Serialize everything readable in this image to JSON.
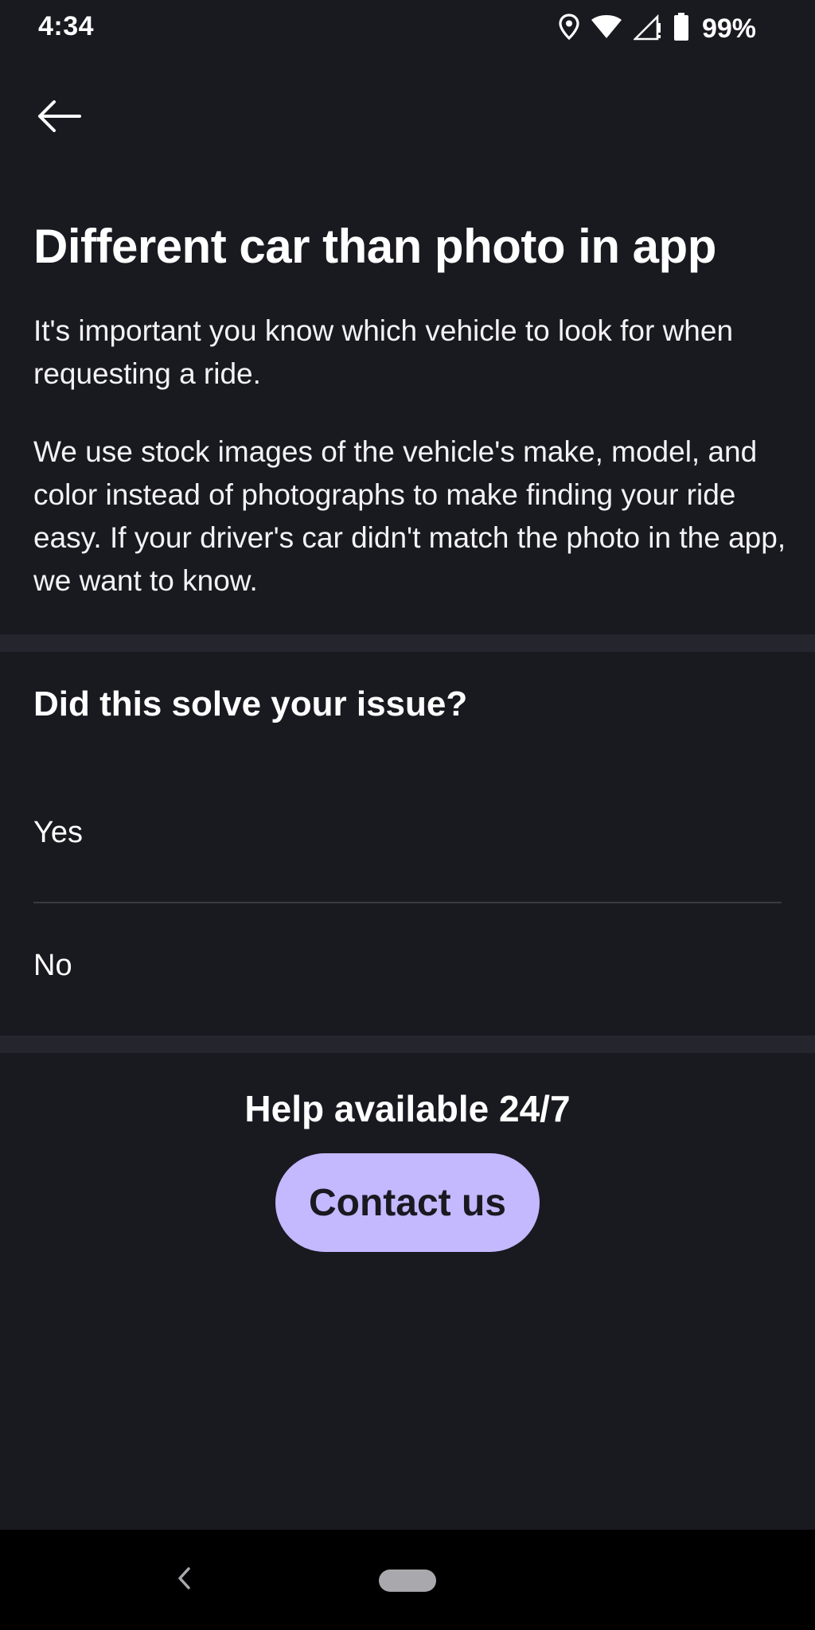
{
  "status_bar": {
    "time": "4:34",
    "battery": "99%",
    "icons": [
      "location-icon",
      "wifi-icon",
      "signal-icon",
      "battery-icon"
    ]
  },
  "header": {
    "back_icon": "arrow-left-icon"
  },
  "article": {
    "title": "Different car than photo in app",
    "paragraph_1": "It's important you know which vehicle to look for when requesting a ride.",
    "paragraph_2": "We use stock images of the vehicle's make, model, and color instead of photographs to make finding your ride easy. If your driver's car didn't match the photo in the app, we want to know."
  },
  "feedback": {
    "question": "Did this solve your issue?",
    "options": [
      {
        "label": "Yes"
      },
      {
        "label": "No"
      }
    ]
  },
  "help": {
    "text": "Help available 24/7",
    "contact_label": "Contact us"
  },
  "colors": {
    "background": "#191920",
    "band": "#25252d",
    "accent": "#c4b8ff",
    "nav_bar": "#000000"
  },
  "nav_bar": {
    "back_icon": "chevron-left-icon",
    "home_icon": "home-pill-icon"
  }
}
